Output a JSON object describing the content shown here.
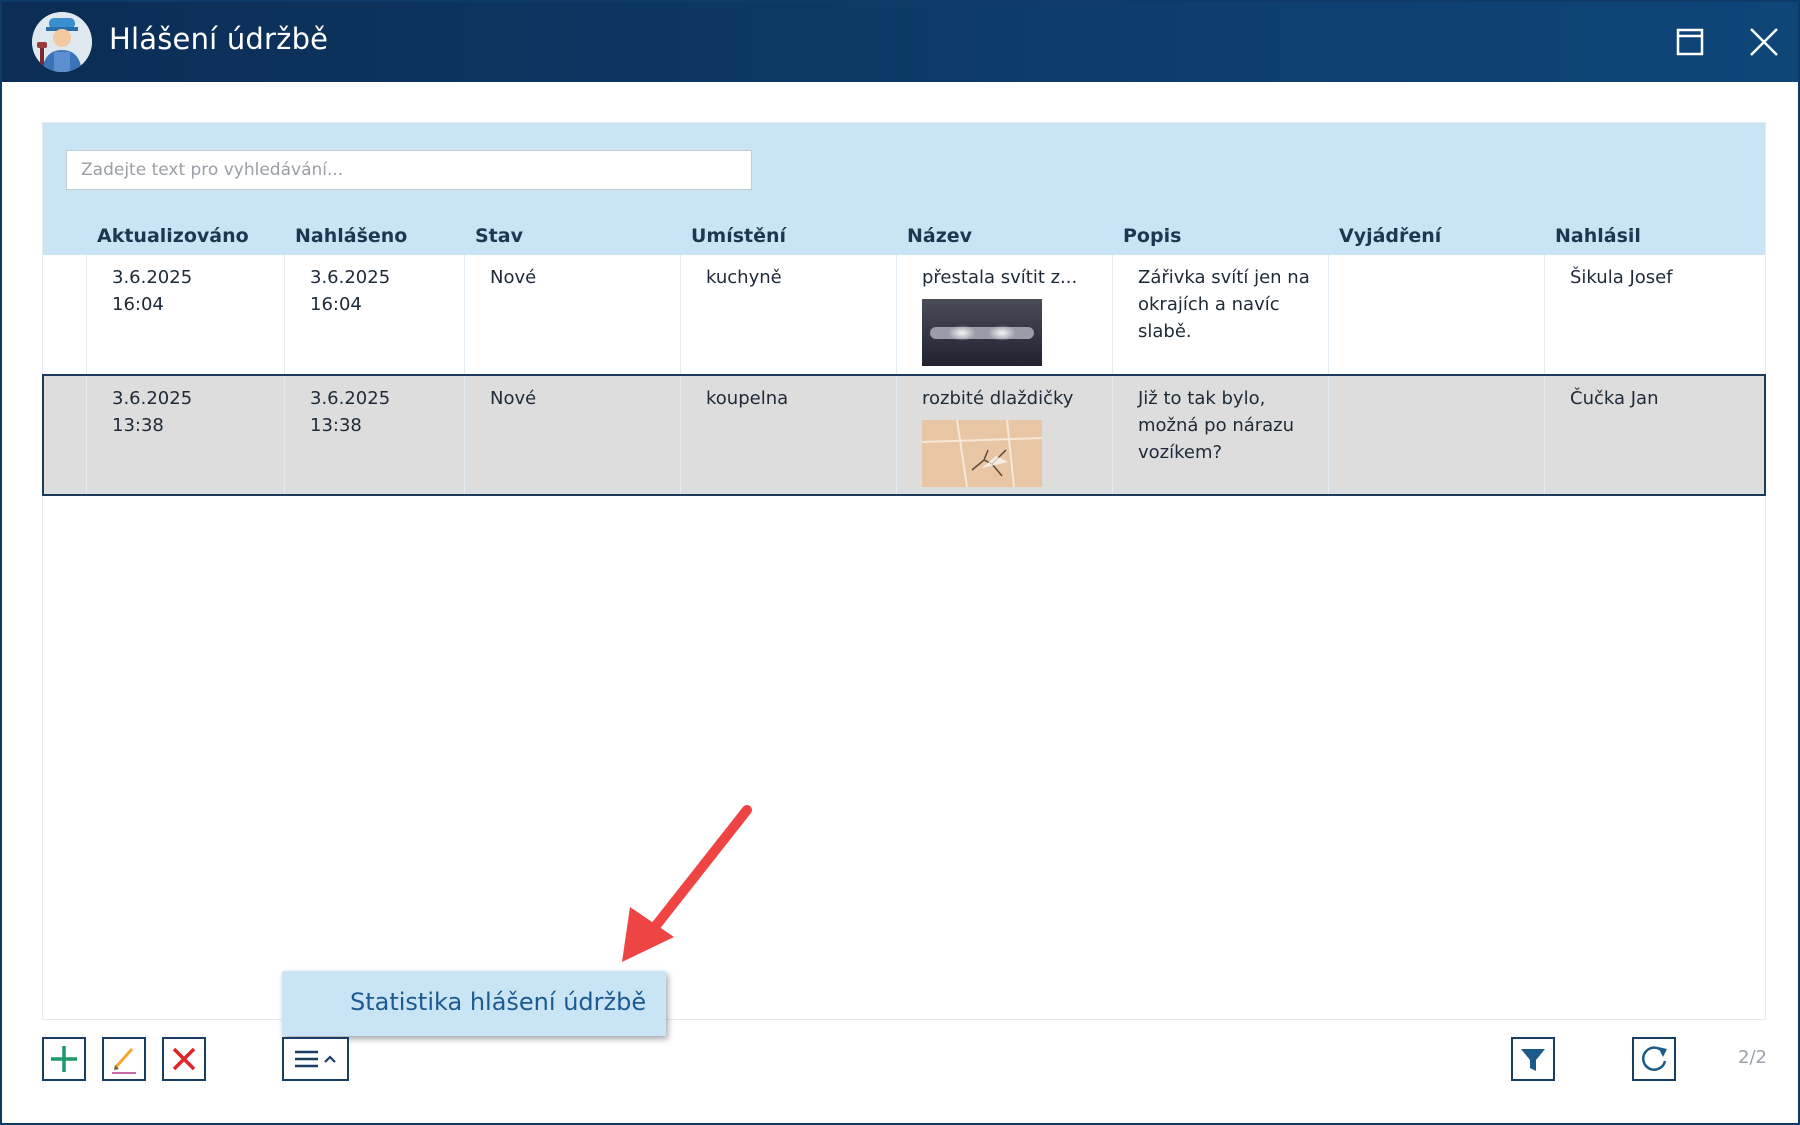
{
  "window": {
    "title": "Hlášení údržbě"
  },
  "search": {
    "placeholder": "Zadejte text pro vyhledávání...",
    "value": ""
  },
  "table": {
    "columns": [
      "Aktualizováno",
      "Nahlášeno",
      "Stav",
      "Umístění",
      "Název",
      "Popis",
      "Vyjádření",
      "Nahlásil"
    ],
    "rows": [
      {
        "updated_date": "3.6.2025",
        "updated_time": "16:04",
        "reported_date": "3.6.2025",
        "reported_time": "16:04",
        "status": "Nové",
        "location": "kuchyně",
        "name": "přestala svítit z...",
        "description": "Zářivka svítí jen na okrajích a navíc slabě.",
        "response": "",
        "reporter": "Šikula Josef",
        "thumbnail": "fluorescent-lamp-photo"
      },
      {
        "updated_date": "3.6.2025",
        "updated_time": "13:38",
        "reported_date": "3.6.2025",
        "reported_time": "13:38",
        "status": "Nové",
        "location": "koupelna",
        "name": "rozbité dlaždičky",
        "description": "Již to tak bylo, možná po nárazu vozíkem?",
        "response": "",
        "reporter": "Čučka Jan",
        "thumbnail": "broken-tiles-photo",
        "selected": true
      }
    ]
  },
  "popup_menu": {
    "items": [
      {
        "label": "Statistika hlášení údržbě"
      }
    ]
  },
  "toolbar": {
    "icons": [
      "plus-icon",
      "pencil-icon",
      "x-icon",
      "menu-icon",
      "filter-icon",
      "refresh-icon"
    ],
    "record_counter": "2/2"
  },
  "colors": {
    "titlebar": "#0b2d55",
    "header_bg": "#c9e5f5",
    "selected_row": "#dddddd",
    "add_green": "#1b9a6b",
    "delete_red": "#e0242c",
    "annotation_arrow": "#ef4444"
  }
}
